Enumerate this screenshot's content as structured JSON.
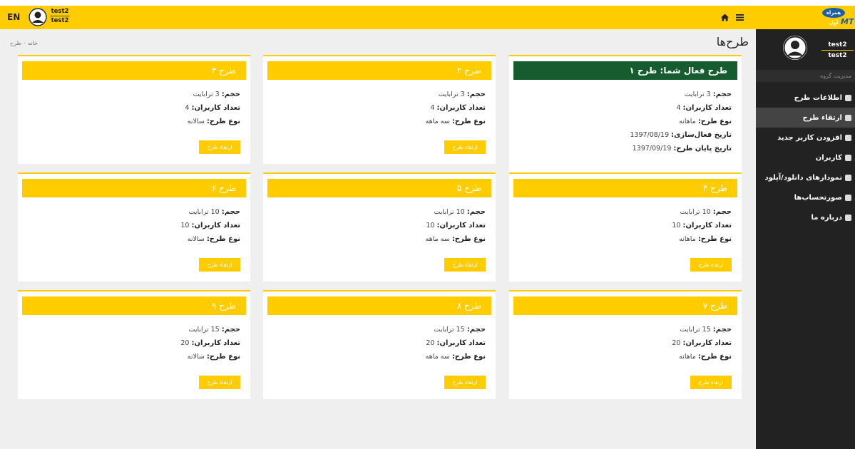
{
  "topbar": {
    "lang": "EN",
    "user_line1": "test2",
    "user_line2": "test2",
    "logo_small": "همراه اول",
    "logo_big": "MT"
  },
  "sidebar": {
    "user_line1": "test2",
    "user_line2": "test2",
    "group_label": "مدیریت گروه",
    "items": [
      {
        "label": "اطلاعات طرح",
        "icon": "info-icon",
        "active": false
      },
      {
        "label": "ارتقاء طرح",
        "icon": "upgrade-icon",
        "active": true
      },
      {
        "label": "افزودن کاربر جدید",
        "icon": "add-user-icon",
        "active": false
      },
      {
        "label": "کاربران",
        "icon": "users-icon",
        "active": false
      },
      {
        "label": "نمودارهای دانلود/آپلود",
        "icon": "chart-icon",
        "active": false
      },
      {
        "label": "صورتحساب‌ها",
        "icon": "bill-icon",
        "active": false
      },
      {
        "label": "درباره ما",
        "icon": "about-icon",
        "active": false
      }
    ]
  },
  "page": {
    "title": "طرح‌ها",
    "breadcrumb_home": "خانه",
    "breadcrumb_current": "طرح"
  },
  "labels": {
    "volume": "حجم:",
    "users": "تعداد کاربران:",
    "type": "نوع طرح:",
    "activation": "تاریخ فعال‌سازی:",
    "end": "تاریخ پایان طرح:",
    "upgrade_button": "ارتقاء طرح"
  },
  "colors": {
    "accent": "#ffcc00",
    "active_plan": "#155d2e",
    "sidebar": "#222222",
    "content_bg": "#efefef"
  },
  "plans": [
    {
      "title": "طرح فعال شما: طرح ۱",
      "volume": "3 ترابایت",
      "users": "4",
      "type": "ماهانه",
      "activation": "1397/08/19",
      "end": "1397/09/19"
    },
    {
      "title": "طرح ۲",
      "volume": "3 ترابایت",
      "users": "4",
      "type": "سه ماهه"
    },
    {
      "title": "طرح ۳",
      "volume": "3 ترابایت",
      "users": "4",
      "type": "سالانه"
    },
    {
      "title": "طرح ۴",
      "volume": "10 ترابایت",
      "users": "10",
      "type": "ماهانه"
    },
    {
      "title": "طرح ۵",
      "volume": "10 ترابایت",
      "users": "10",
      "type": "سه ماهه"
    },
    {
      "title": "طرح ۶",
      "volume": "10 ترابایت",
      "users": "10",
      "type": "سالانه"
    },
    {
      "title": "طرح ۷",
      "volume": "15 ترابایت",
      "users": "20",
      "type": "ماهانه"
    },
    {
      "title": "طرح ۸",
      "volume": "15 ترابایت",
      "users": "20",
      "type": "سه ماهه"
    },
    {
      "title": "طرح ۹",
      "volume": "15 ترابایت",
      "users": "20",
      "type": "سالانه"
    }
  ]
}
